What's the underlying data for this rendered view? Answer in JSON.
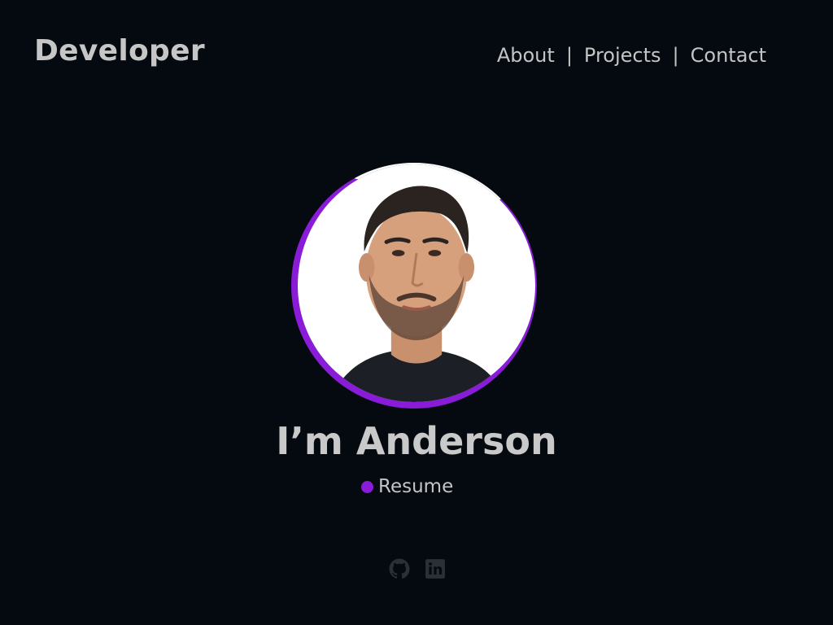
{
  "header": {
    "logo": "Developer",
    "nav": [
      {
        "label": "About"
      },
      {
        "label": "Projects"
      },
      {
        "label": "Contact"
      }
    ],
    "separator": "|"
  },
  "hero": {
    "name": "I’m Anderson",
    "resume_label": "Resume",
    "avatar_icon": "profile-photo"
  },
  "social": [
    {
      "icon": "github-icon"
    },
    {
      "icon": "linkedin-icon"
    }
  ],
  "colors": {
    "background": "#050a10",
    "accent": "#8a1bd9",
    "text": "#c4c4c4",
    "social_icon": "#2b2f36"
  }
}
